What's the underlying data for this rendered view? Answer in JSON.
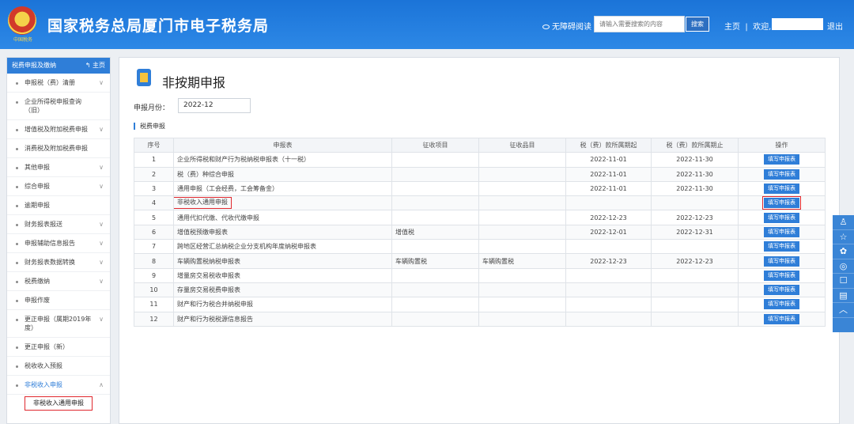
{
  "header": {
    "emblem_text": "中国税务",
    "title": "国家税务总局厦门市电子税务局",
    "accessibility": "无障碍阅读",
    "search_placeholder": "请输入需要搜索的内容",
    "search_button": "搜索",
    "home": "主页",
    "welcome": "欢迎,",
    "logout": "退出"
  },
  "sidebar": {
    "header": "税费申报及缴纳",
    "home_link": "主页",
    "items": [
      {
        "label": "申报税（费）清册",
        "chev": "∨"
      },
      {
        "label": "企业所得税申报查询（旧）",
        "chev": ""
      },
      {
        "label": "增值税及附加税费申报",
        "chev": "∨"
      },
      {
        "label": "消费税及附加税费申报",
        "chev": ""
      },
      {
        "label": "其他申报",
        "chev": "∨"
      },
      {
        "label": "综合申报",
        "chev": "∨"
      },
      {
        "label": "逾期申报",
        "chev": ""
      },
      {
        "label": "财务报表报送",
        "chev": "∨"
      },
      {
        "label": "申报辅助信息报告",
        "chev": "∨"
      },
      {
        "label": "财务报表数据转换",
        "chev": "∨"
      },
      {
        "label": "税费缴纳",
        "chev": "∨"
      },
      {
        "label": "申报作废",
        "chev": ""
      },
      {
        "label": "更正申报（属期2019年度）",
        "chev": "∨"
      },
      {
        "label": "更正申报（新）",
        "chev": ""
      },
      {
        "label": "税收收入预报",
        "chev": ""
      },
      {
        "label": "非税收入申报",
        "chev": "∧"
      }
    ],
    "sub_item": "非税收入通用申报"
  },
  "main": {
    "title": "非按期申报",
    "month_label": "申报月份：",
    "month_value": "2022-12",
    "section": "税费申报",
    "columns": [
      "序号",
      "申报表",
      "征收项目",
      "征收品目",
      "税（费）款所属期起",
      "税（费）款所属期止",
      "操作"
    ],
    "button_label": "填写申报表",
    "rows": [
      {
        "no": "1",
        "name": "企业所得税和财产行为税纳税申报表（十一税）",
        "item": "",
        "sub": "",
        "start": "2022-11-01",
        "end": "2022-11-30"
      },
      {
        "no": "2",
        "name": "税（费）种综合申报",
        "item": "",
        "sub": "",
        "start": "2022-11-01",
        "end": "2022-11-30"
      },
      {
        "no": "3",
        "name": "通用申报（工会经费，工会筹备金）",
        "item": "",
        "sub": "",
        "start": "2022-11-01",
        "end": "2022-11-30"
      },
      {
        "no": "4",
        "name": "非税收入通用申报",
        "item": "",
        "sub": "",
        "start": "",
        "end": ""
      },
      {
        "no": "5",
        "name": "通用代扣代缴、代收代缴申报",
        "item": "",
        "sub": "",
        "start": "2022-12-23",
        "end": "2022-12-23"
      },
      {
        "no": "6",
        "name": "增值税预缴申报表",
        "item": "增值税",
        "sub": "",
        "start": "2022-12-01",
        "end": "2022-12-31"
      },
      {
        "no": "7",
        "name": "跨地区经营汇总纳税企业分支机构年度纳税申报表",
        "item": "",
        "sub": "",
        "start": "",
        "end": ""
      },
      {
        "no": "8",
        "name": "车辆购置税纳税申报表",
        "item": "车辆购置税",
        "sub": "车辆购置税",
        "start": "2022-12-23",
        "end": "2022-12-23"
      },
      {
        "no": "9",
        "name": "增量房交易税收申报表",
        "item": "",
        "sub": "",
        "start": "",
        "end": ""
      },
      {
        "no": "10",
        "name": "存量房交易税费申报表",
        "item": "",
        "sub": "",
        "start": "",
        "end": ""
      },
      {
        "no": "11",
        "name": "财产和行为税合并纳税申报",
        "item": "",
        "sub": "",
        "start": "",
        "end": ""
      },
      {
        "no": "12",
        "name": "财产和行为税税源信息报告",
        "item": "",
        "sub": "",
        "start": "",
        "end": ""
      }
    ],
    "highlight_row": 3
  },
  "float_bar": [
    "user-icon",
    "star-icon",
    "share-icon",
    "weibo-icon",
    "message-icon",
    "document-icon",
    "chevron-up-icon"
  ],
  "colors": {
    "primary": "#2f7ed8",
    "highlight": "#e0282e"
  }
}
